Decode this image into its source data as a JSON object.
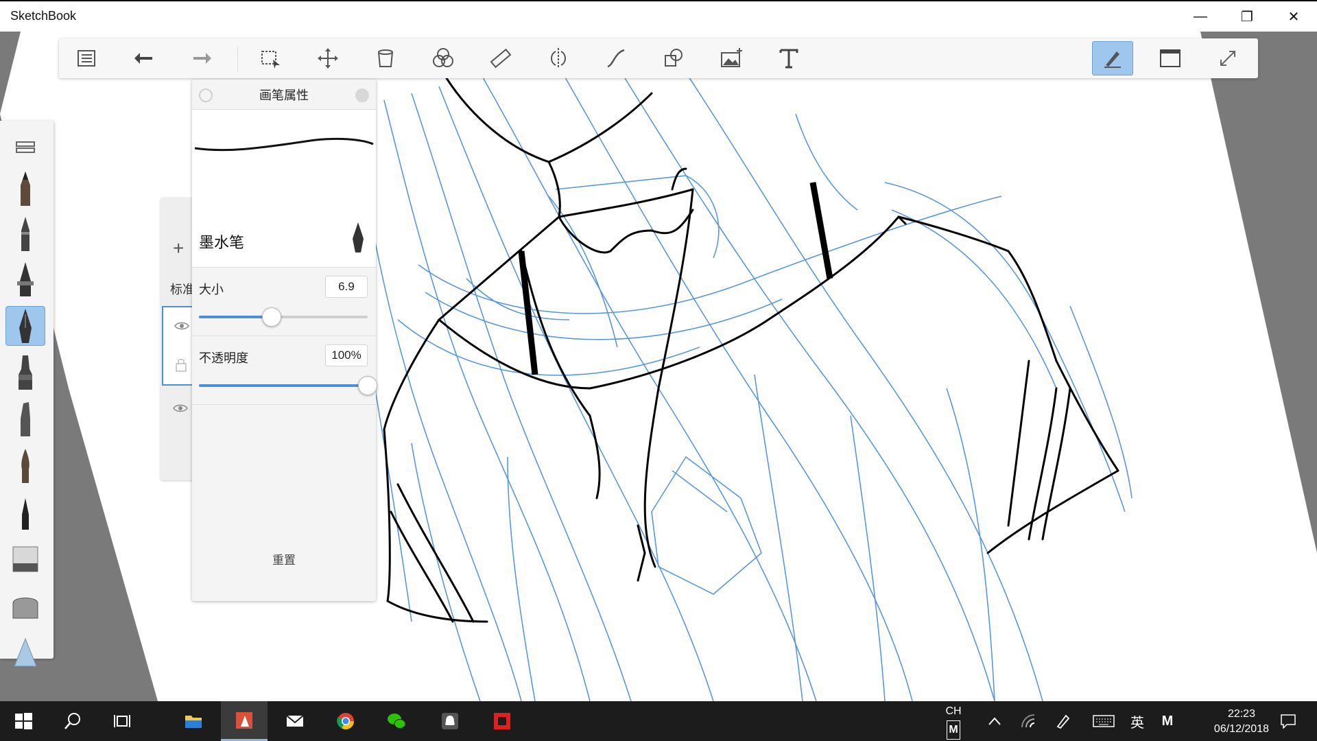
{
  "app": {
    "title": "SketchBook"
  },
  "window_controls": {
    "minimize": "—",
    "restore": "❐",
    "close": "✕"
  },
  "toolbar": {
    "items": [
      "layer-editor",
      "undo",
      "redo",
      "select",
      "transform",
      "fill",
      "color-editor",
      "ruler",
      "symmetry",
      "steady-stroke",
      "shapes",
      "add-image",
      "text"
    ],
    "right_items": [
      "brush-mode",
      "canvas-view",
      "fullscreen"
    ]
  },
  "layers": {
    "add_label": "+",
    "label": "标准"
  },
  "brush_props": {
    "title": "画笔属性",
    "brush_name": "墨水笔",
    "size": {
      "label": "大小",
      "value": "6.9",
      "fraction": 0.43
    },
    "opacity": {
      "label": "不透明度",
      "value": "100%",
      "fraction": 1.0
    },
    "reset_label": "重置"
  },
  "palette": {
    "items": [
      "pencil",
      "ballpoint",
      "technical-pen",
      "ink-pen",
      "marker",
      "chisel-marker",
      "brush-pen",
      "fine-brush",
      "hard-eraser",
      "soft-eraser",
      "airbrush"
    ],
    "active": "ink-pen"
  },
  "taskbar": {
    "apps": [
      "start",
      "search",
      "task-view",
      "file-explorer",
      "sketchbook",
      "mail",
      "chrome",
      "wechat",
      "qq",
      "app-red"
    ],
    "active_app": "sketchbook",
    "tray": {
      "lang": "CH",
      "ime_mode": "M",
      "ime_lang": "英",
      "ime_m": "M"
    },
    "time": "22:23",
    "date": "06/12/2018"
  },
  "colors": {
    "accent": "#4a90d9",
    "active_bg": "#9fc7ee",
    "sketch_blue": "#3d86d6",
    "ink": "#000000"
  }
}
